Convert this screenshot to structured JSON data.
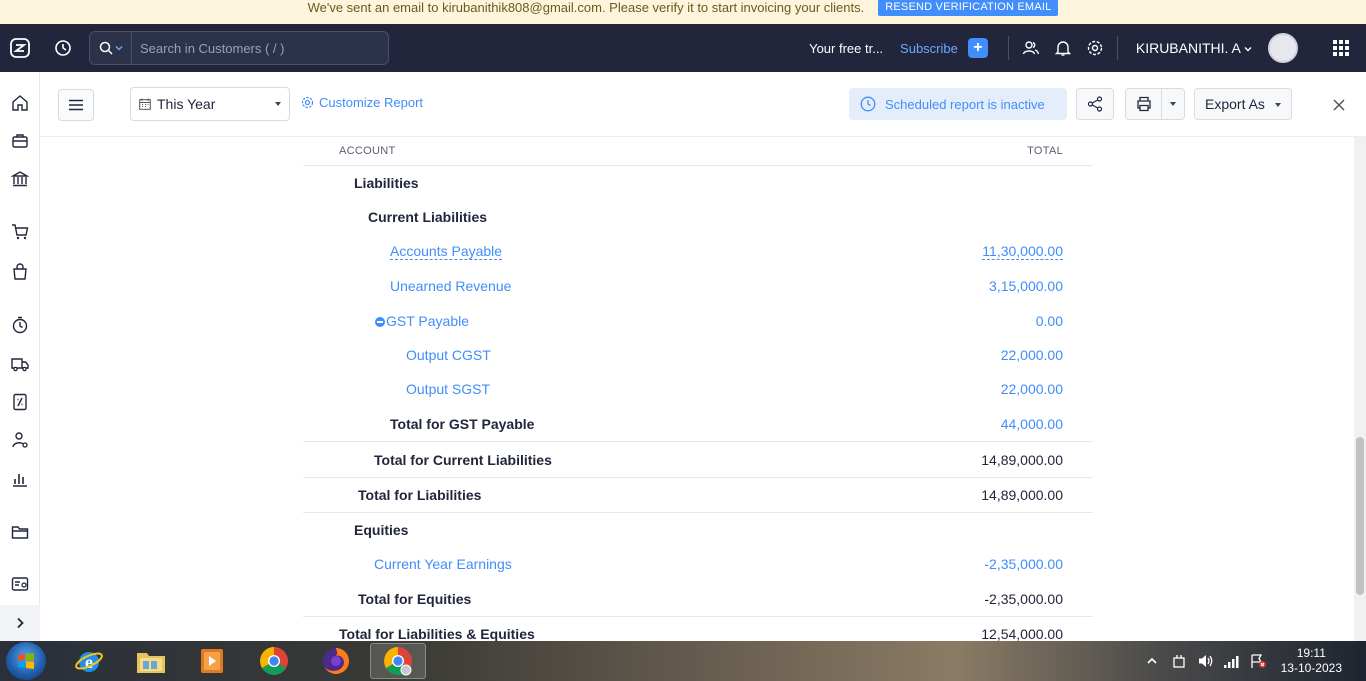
{
  "banner": {
    "message": "We've sent an email to kirubanithik808@gmail.com. Please verify it to start invoicing your clients.",
    "resend_label": "RESEND VERIFICATION EMAIL"
  },
  "topbar": {
    "search_placeholder": "Search in Customers ( / )",
    "trial_text": "Your free tr...",
    "subscribe_label": "Subscribe",
    "plus_label": "+",
    "user_name": "KIRUBANITHI. A"
  },
  "toolbar": {
    "period_value": "This Year",
    "customize_label": "Customize Report",
    "scheduled_label": "Scheduled report is inactive",
    "export_label": "Export As"
  },
  "report": {
    "col_account": "ACCOUNT",
    "col_total": "TOTAL",
    "rows": [
      {
        "label": "Liabilities",
        "amount": ""
      },
      {
        "label": "Current Liabilities",
        "amount": ""
      },
      {
        "label": "Accounts Payable",
        "amount": "11,30,000.00"
      },
      {
        "label": "Unearned Revenue",
        "amount": "3,15,000.00"
      },
      {
        "label": "GST Payable",
        "amount": "0.00"
      },
      {
        "label": "Output CGST",
        "amount": "22,000.00"
      },
      {
        "label": "Output SGST",
        "amount": "22,000.00"
      },
      {
        "label": "Total for GST Payable",
        "amount": "44,000.00"
      },
      {
        "label": "Total for Current Liabilities",
        "amount": "14,89,000.00"
      },
      {
        "label": "Total for Liabilities",
        "amount": "14,89,000.00"
      },
      {
        "label": "Equities",
        "amount": ""
      },
      {
        "label": "Current Year Earnings",
        "amount": "-2,35,000.00"
      },
      {
        "label": "Total for Equities",
        "amount": "-2,35,000.00"
      },
      {
        "label": "Total for Liabilities & Equities",
        "amount": "12,54,000.00"
      }
    ]
  },
  "taskbar": {
    "time": "19:11",
    "date": "13-10-2023"
  },
  "colors": {
    "accent": "#408dfb",
    "topbar_bg": "#21263c",
    "banner_bg": "#fdf6dc"
  }
}
